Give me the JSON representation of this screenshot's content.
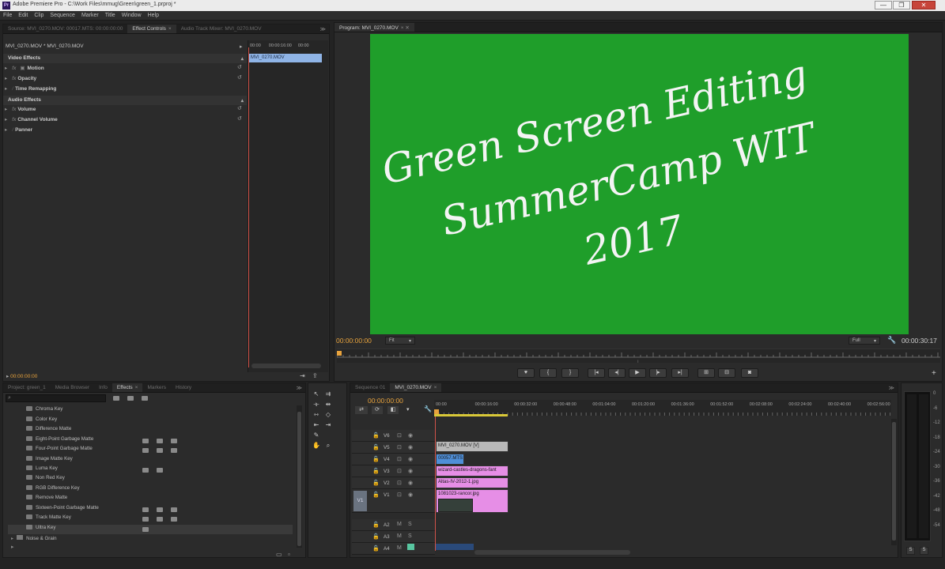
{
  "app": {
    "title": "Adobe Premiere Pro - C:\\Work Files\\mmug\\Green\\green_1.prproj *",
    "icon": "Pr"
  },
  "window": {
    "minimize": "—",
    "restore": "❐",
    "close": "✕"
  },
  "menu": [
    "File",
    "Edit",
    "Clip",
    "Sequence",
    "Marker",
    "Title",
    "Window",
    "Help"
  ],
  "source_panel": {
    "tabs": [
      "Source: MVI_0270.MOV: 00017.MTS: 00:00:00:00",
      "Effect Controls",
      "Audio Track Mixer: MVI_0270.MOV"
    ],
    "breadcrumb": "MVI_0270.MOV * MVI_0270.MOV",
    "video_effects": "Video Effects",
    "audio_effects": "Audio Effects",
    "rows": [
      "Motion",
      "Opacity",
      "Time Remapping",
      "Volume",
      "Channel Volume",
      "Panner"
    ],
    "timecode": "00:00:00:00",
    "mini_ruler": [
      "00:00",
      "00:00:16:00",
      "00:00"
    ],
    "mini_clip": "MVI_0270.MOV"
  },
  "program": {
    "tab": "Program: MVI_0270.MOV",
    "video_text": [
      "Green Screen Editing",
      "SummerCamp WIT",
      "2017"
    ],
    "video_bg": "#1f9e2a",
    "timecode_left": "00:00:00:00",
    "zoom": "Fit",
    "quality": "Full",
    "timecode_right": "00:00:30:17",
    "controls": [
      "♥",
      "{",
      "}",
      "|◂",
      "◂|",
      "▶",
      "|▸",
      "▸|",
      "⊞",
      "⊟",
      "◙"
    ]
  },
  "project": {
    "tabs": [
      "Project: green_1",
      "Media Browser",
      "Info",
      "Effects",
      "Markers",
      "History"
    ],
    "items": [
      "Chroma Key",
      "Color Key",
      "Difference Matte",
      "Eight-Point Garbage Matte",
      "Four-Point Garbage Matte",
      "Image Matte Key",
      "Luma Key",
      "Non Red Key",
      "RGB Difference Key",
      "Remove Matte",
      "Sixteen-Point Garbage Matte",
      "Track Matte Key",
      "Ultra Key"
    ],
    "folder": "Noise & Grain"
  },
  "timeline": {
    "tabs": [
      "Sequence 01",
      "MVI_0270.MOV"
    ],
    "timecode": "00:00:00:00",
    "ruler": [
      "00:00",
      "00:00:16:00",
      "00:00:32:00",
      "00:00:48:00",
      "00:01:04:00",
      "00:01:20:00",
      "00:01:36:00",
      "00:01:52:00",
      "00:02:08:00",
      "00:02:24:00",
      "00:02:40:00",
      "00:02:56:00"
    ],
    "tracks": [
      "V6",
      "V5",
      "V4",
      "V3",
      "V2",
      "V1",
      "A1",
      "A2",
      "A3",
      "A4"
    ],
    "source_patch": "V1",
    "clips": [
      {
        "label": "MVI_0270.MOV [V]",
        "color": "#b9b9b9"
      },
      {
        "label": "00057.MTS",
        "color": "#4f8fd8"
      },
      {
        "label": "wizard-castles-dragons-fant",
        "color": "#e68ee6"
      },
      {
        "label": "Altas-IV-2012-1.jpg",
        "color": "#e68ee6"
      },
      {
        "label": "1081023-rancor.jpg",
        "color": "#e68ee6"
      }
    ]
  },
  "meter": {
    "labels": [
      "0",
      "-6",
      "-12",
      "-18",
      "-24",
      "-30",
      "-36",
      "-42",
      "-48",
      "-54"
    ],
    "buttons": [
      "S",
      "S"
    ]
  }
}
